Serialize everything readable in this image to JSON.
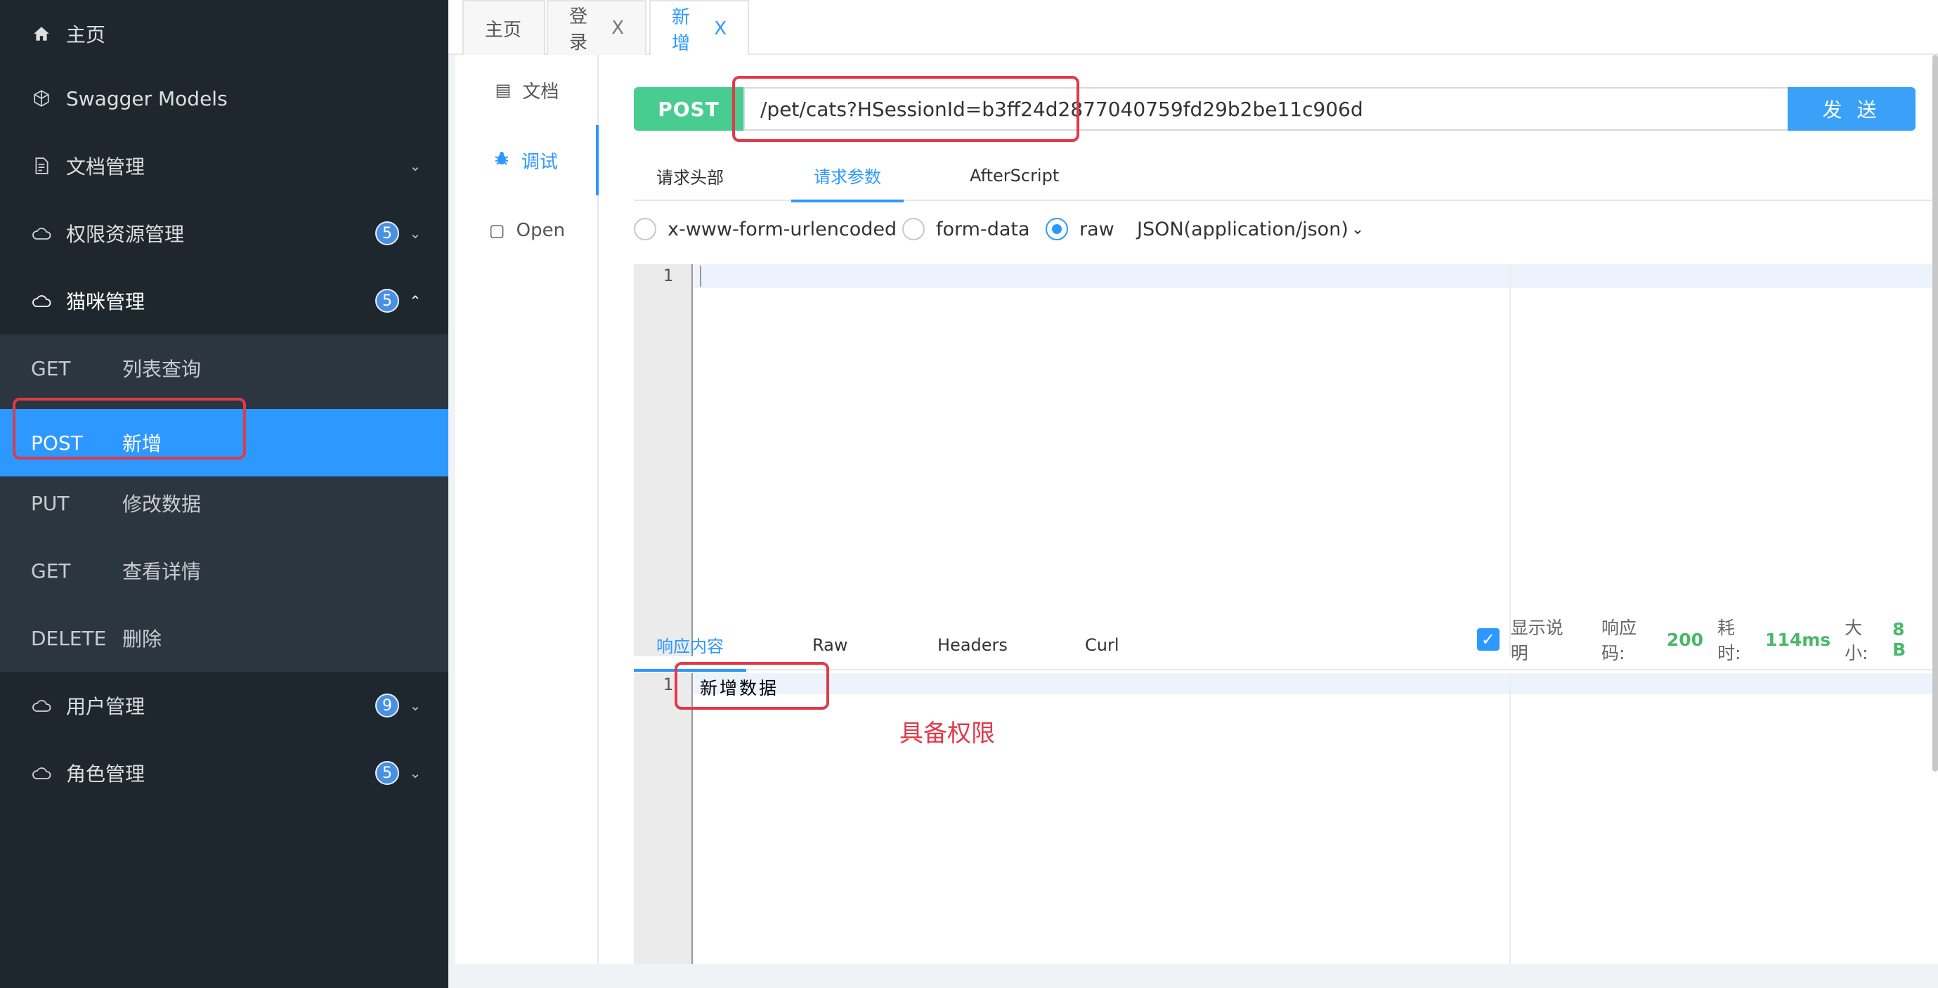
{
  "sidebar": {
    "items": [
      {
        "label": "主页",
        "icon": "home-icon"
      },
      {
        "label": "Swagger Models",
        "icon": "cube-icon"
      },
      {
        "label": "文档管理",
        "icon": "document-icon"
      },
      {
        "label": "权限资源管理",
        "icon": "cloud-icon",
        "badge": "5"
      },
      {
        "label": "猫咪管理",
        "icon": "cloud-icon",
        "badge": "5"
      },
      {
        "label": "用户管理",
        "icon": "cloud-icon",
        "badge": "9"
      },
      {
        "label": "角色管理",
        "icon": "cloud-icon",
        "badge": "5"
      }
    ],
    "submenu": [
      {
        "method": "GET",
        "label": "列表查询"
      },
      {
        "method": "POST",
        "label": "新增"
      },
      {
        "method": "PUT",
        "label": "修改数据"
      },
      {
        "method": "GET",
        "label": "查看详情"
      },
      {
        "method": "DELETE",
        "label": "删除"
      }
    ]
  },
  "tabs": [
    {
      "label": "主页"
    },
    {
      "label": "登录",
      "close": "X"
    },
    {
      "label": "新增",
      "close": "X"
    }
  ],
  "leftnav": [
    {
      "label": "文档",
      "icon": "document-icon"
    },
    {
      "label": "调试",
      "icon": "bug-icon"
    },
    {
      "label": "Open",
      "icon": "file-icon"
    }
  ],
  "request": {
    "method": "POST",
    "url": "/pet/cats?HSessionId=b3ff24d2877040759fd29b2be11c906d",
    "send": "发 送",
    "tabs": [
      "请求头部",
      "请求参数",
      "AfterScript"
    ],
    "body_types": [
      "x-www-form-urlencoded",
      "form-data",
      "raw"
    ],
    "content_type": "JSON(application/json)",
    "line_number": "1"
  },
  "response": {
    "tabs": [
      "响应内容",
      "Raw",
      "Headers",
      "Curl"
    ],
    "show_desc": "显示说明",
    "code_label": "响应码:",
    "code": "200",
    "time_label": "耗时:",
    "time": "114ms",
    "size_label": "大小:",
    "size": "8 B",
    "line_number": "1",
    "body": "新增数据"
  },
  "annotation": "具备权限",
  "colors": {
    "sidebar_bg": "#1e272e",
    "active": "#2d98ff",
    "post": "#49cc90",
    "highlight": "#e03a4a"
  }
}
